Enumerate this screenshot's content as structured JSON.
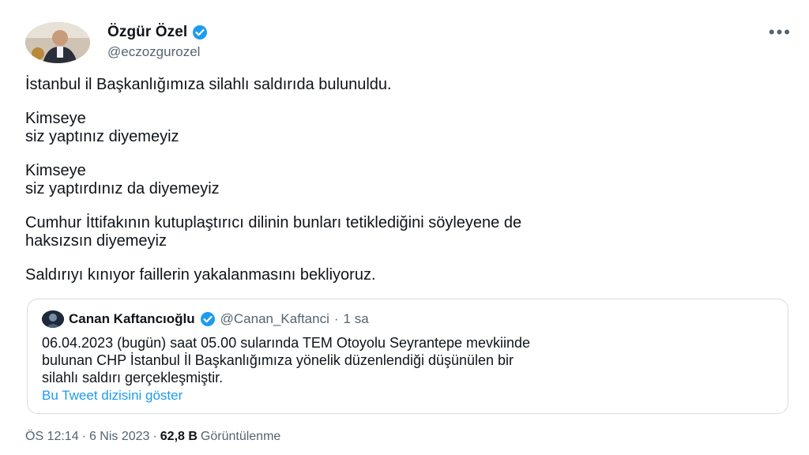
{
  "author": {
    "display_name": "Özgür Özel",
    "handle": "@eczozgurozel"
  },
  "more_label": "•••",
  "tweet": {
    "paragraphs": [
      [
        "İstanbul il Başkanlığımıza silahlı saldırıda bulunuldu."
      ],
      [
        "Kimseye",
        "siz yaptınız diyemeyiz"
      ],
      [
        "Kimseye",
        "siz yaptırdınız da diyemeyiz"
      ],
      [
        "Cumhur İttifakının kutuplaştırıcı dilinin bunları tetiklediğini söyleyene de",
        "haksızsın diyemeyiz"
      ],
      [
        "Saldırıyı kınıyor faillerin yakalanmasını bekliyoruz."
      ]
    ]
  },
  "quoted": {
    "display_name": "Canan Kaftancıoğlu",
    "handle": "@Canan_Kaftanci",
    "separator": "·",
    "time": "1 sa",
    "lines": [
      "06.04.2023 (bugün) saat 05.00 sularında TEM Otoyolu Seyrantepe mevkiinde",
      "bulunan CHP İstanbul İl Başkanlığımıza yönelik düzenlendiği düşünülen bir",
      "silahlı saldırı gerçekleşmiştir."
    ],
    "show_thread": "Bu Tweet dizisini göster"
  },
  "meta": {
    "time": "ÖS 12:14",
    "sep1": "·",
    "date": "6 Nis 2023",
    "sep2": "·",
    "views_count": "62,8 B",
    "views_label": "Görüntülenme"
  },
  "colors": {
    "verified": "#1d9bf0",
    "link": "#1d9bf0",
    "muted": "#536471"
  },
  "icons": {
    "verified": "verified-badge-icon",
    "more": "more-options-icon"
  }
}
